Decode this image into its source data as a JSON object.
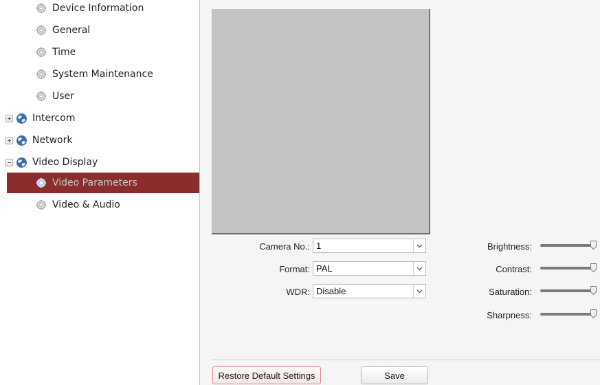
{
  "sidebar": {
    "items": [
      {
        "label": "Device Information",
        "kind": "child",
        "icon": "gear-icon"
      },
      {
        "label": "General",
        "kind": "child",
        "icon": "gear-icon"
      },
      {
        "label": "Time",
        "kind": "child",
        "icon": "gear-icon"
      },
      {
        "label": "System Maintenance",
        "kind": "child",
        "icon": "gear-icon"
      },
      {
        "label": "User",
        "kind": "child",
        "icon": "gear-icon"
      },
      {
        "label": "Intercom",
        "kind": "group",
        "expander": "plus",
        "icon": "globe-icon"
      },
      {
        "label": "Network",
        "kind": "group",
        "expander": "plus",
        "icon": "globe-icon"
      },
      {
        "label": "Video Display",
        "kind": "group",
        "expander": "minus",
        "icon": "globe-icon"
      },
      {
        "label": "Video Parameters",
        "kind": "child",
        "icon": "gear-icon",
        "active": true
      },
      {
        "label": "Video & Audio",
        "kind": "child",
        "icon": "gear-icon"
      }
    ],
    "active_color": "#8b2d2d"
  },
  "form": {
    "camera_no": {
      "label": "Camera No.:",
      "value": "1"
    },
    "format": {
      "label": "Format:",
      "value": "PAL"
    },
    "wdr": {
      "label": "WDR:",
      "value": "Disable"
    }
  },
  "adjustments": {
    "brightness": {
      "label": "Brightness:",
      "level": 1.0
    },
    "contrast": {
      "label": "Contrast:",
      "level": 1.0
    },
    "saturation": {
      "label": "Saturation:",
      "level": 1.0
    },
    "sharpness": {
      "label": "Sharpness:",
      "level": 1.0
    }
  },
  "buttons": {
    "restore": "Restore Default Settings",
    "save": "Save"
  }
}
